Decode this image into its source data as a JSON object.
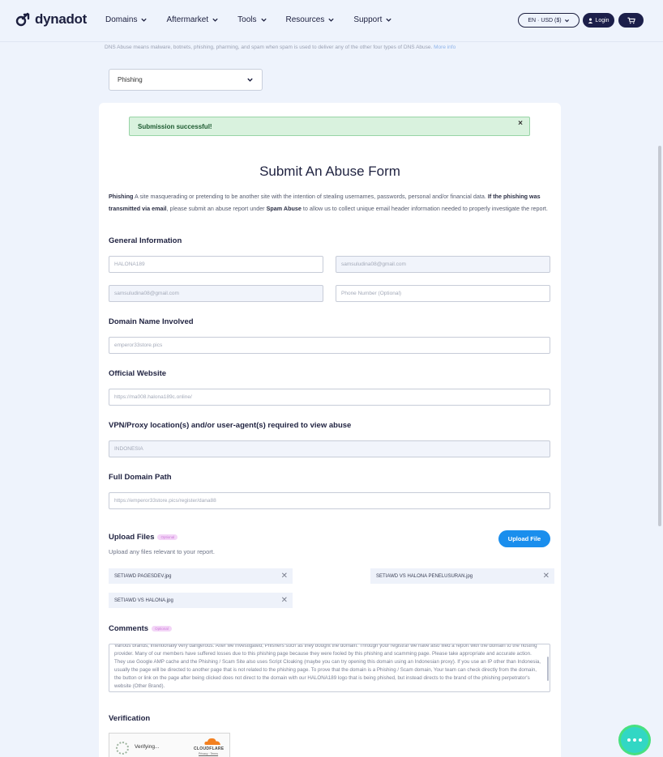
{
  "brand": {
    "name": "dynadot"
  },
  "nav": {
    "items": [
      {
        "label": "Domains"
      },
      {
        "label": "Aftermarket"
      },
      {
        "label": "Tools"
      },
      {
        "label": "Resources"
      },
      {
        "label": "Support"
      }
    ],
    "lang_label": "EN · USD ($)",
    "login_label": "Login"
  },
  "dns_note": {
    "text": "DNS Abuse means malware, botnets, phishing, pharming, and spam when spam is used to deliver any of the other four types of DNS Abuse.",
    "link": "More info"
  },
  "abuse_type_select": {
    "value": "Phishing"
  },
  "alert": {
    "message": "Submission successful!",
    "close": "×"
  },
  "form": {
    "title": "Submit An Abuse Form",
    "description": {
      "term": "Phishing",
      "text1": " A site masquerading or pretending to be another site with the intention of stealing usernames, passwords, personal and/or financial data. ",
      "bold2": "If the phishing was transmitted via email",
      "text2": ", please submit an abuse report under ",
      "bold3": "Spam Abuse",
      "text3": " to allow us to collect unique email header information needed to properly investigate the report."
    },
    "general_info": {
      "label": "General Information",
      "name_value": "HALONA189",
      "email_value": "samsuludina08@gmail.com",
      "confirm_email_value": "samsuludina08@gmail.com",
      "phone_placeholder": "Phone Number (Optional)"
    },
    "domain_name": {
      "label": "Domain Name Involved",
      "value": "emperor33store.pics"
    },
    "official_website": {
      "label": "Official Website",
      "value": "https://ma008.halona189c.online/"
    },
    "vpn": {
      "label": "VPN/Proxy location(s) and/or user-agent(s) required to view abuse",
      "value": "INDONESIA"
    },
    "full_path": {
      "label": "Full Domain Path",
      "value": "https://emperor33store.pics/register/dana88"
    },
    "upload": {
      "label": "Upload Files",
      "optional": "Optional",
      "hint": "Upload any files relevant to your report.",
      "button": "Upload File",
      "files": [
        {
          "name": "SETIAWD PAGESDEV.jpg"
        },
        {
          "name": "SETIAWD VS HALONA PENELUSURAN.jpg"
        },
        {
          "name": "SETIAWD VS HALONA.jpg"
        }
      ]
    },
    "comments": {
      "label": "Comments",
      "optional": "Optional",
      "text": "Various brands, intentionally very dangerous. After we investigated, Phishers such as they bought the domain. Through your registrar we have also filed a report with the domain to the hosting provider. Many of our members have suffered losses due to this phishing page because they were fooled by this phishing and scamming page. Please take appropriate and accurate action. They use Google AMP cache and the Phishing / Scam Site also uses Script Cloaking (maybe you can try opening this domain using an Indonesian proxy). If you use an IP other than Indonesia, usually the page will be directed to another page that is not related to the phishing page. To prove that the domain is a Phishing / Scam domain, Your team can check directly from the domain, the button or link on the page after being clicked does not direct to the domain with our HALONA189 logo that is being phished, but instead directs to the brand of the phishing perpetrator's website (Other Brand)."
    },
    "verification": {
      "label": "Verification",
      "status": "Verifying...",
      "provider": "CLOUDFLARE",
      "links": "Privacy · Terms"
    }
  },
  "colors": {
    "page_bg": "#eef3fc",
    "brand_dark": "#1c1f4a",
    "accent_blue": "#1a8eed",
    "success_bg": "#d9f2de",
    "chat": "#32d7c4"
  }
}
